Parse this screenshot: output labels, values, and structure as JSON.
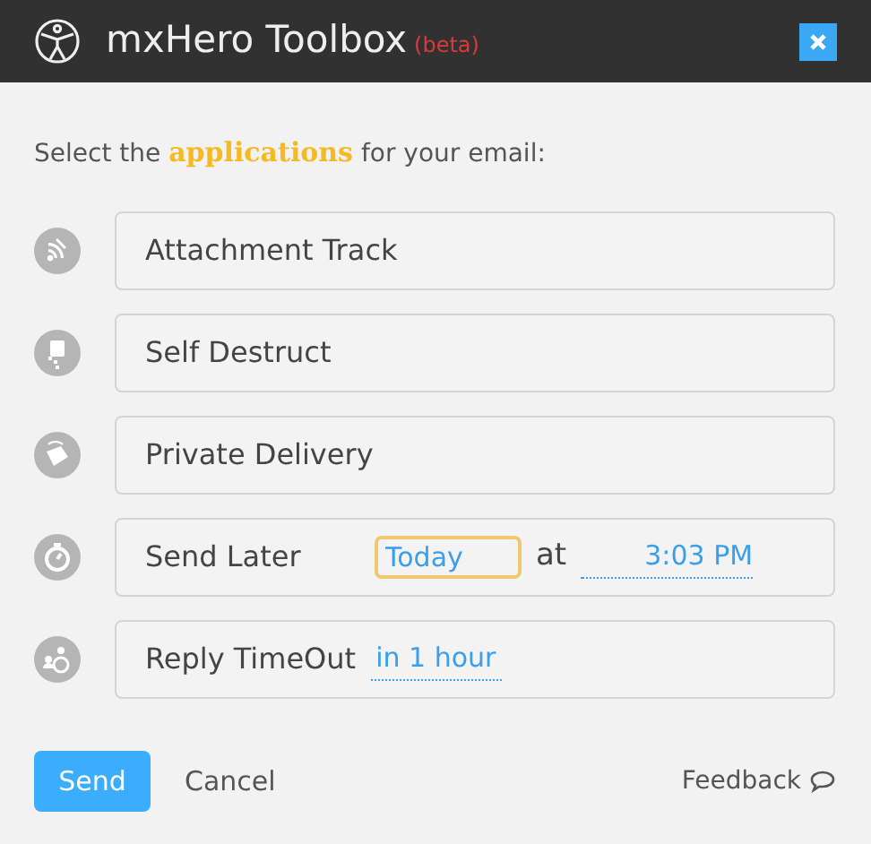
{
  "header": {
    "title": "mxHero Toolbox",
    "badge": "(beta)"
  },
  "prompt": "Select the **applications** for your email:",
  "apps": [
    {
      "kind": "plain",
      "label": "Attachment Track"
    },
    {
      "kind": "plain",
      "label": "Self Destruct"
    },
    {
      "kind": "plain",
      "label": "Private Delivery"
    },
    {
      "kind": "schedule",
      "label": "Send Later",
      "date": "Today",
      "date_focused": true,
      "joiner": "at",
      "time": "3:03 PM"
    },
    {
      "kind": "timeout",
      "label": "Reply TimeOut",
      "value": "in 1 hour"
    }
  ],
  "footer": {
    "send": "Send",
    "cancel": "Cancel",
    "feedback": "Feedback"
  }
}
